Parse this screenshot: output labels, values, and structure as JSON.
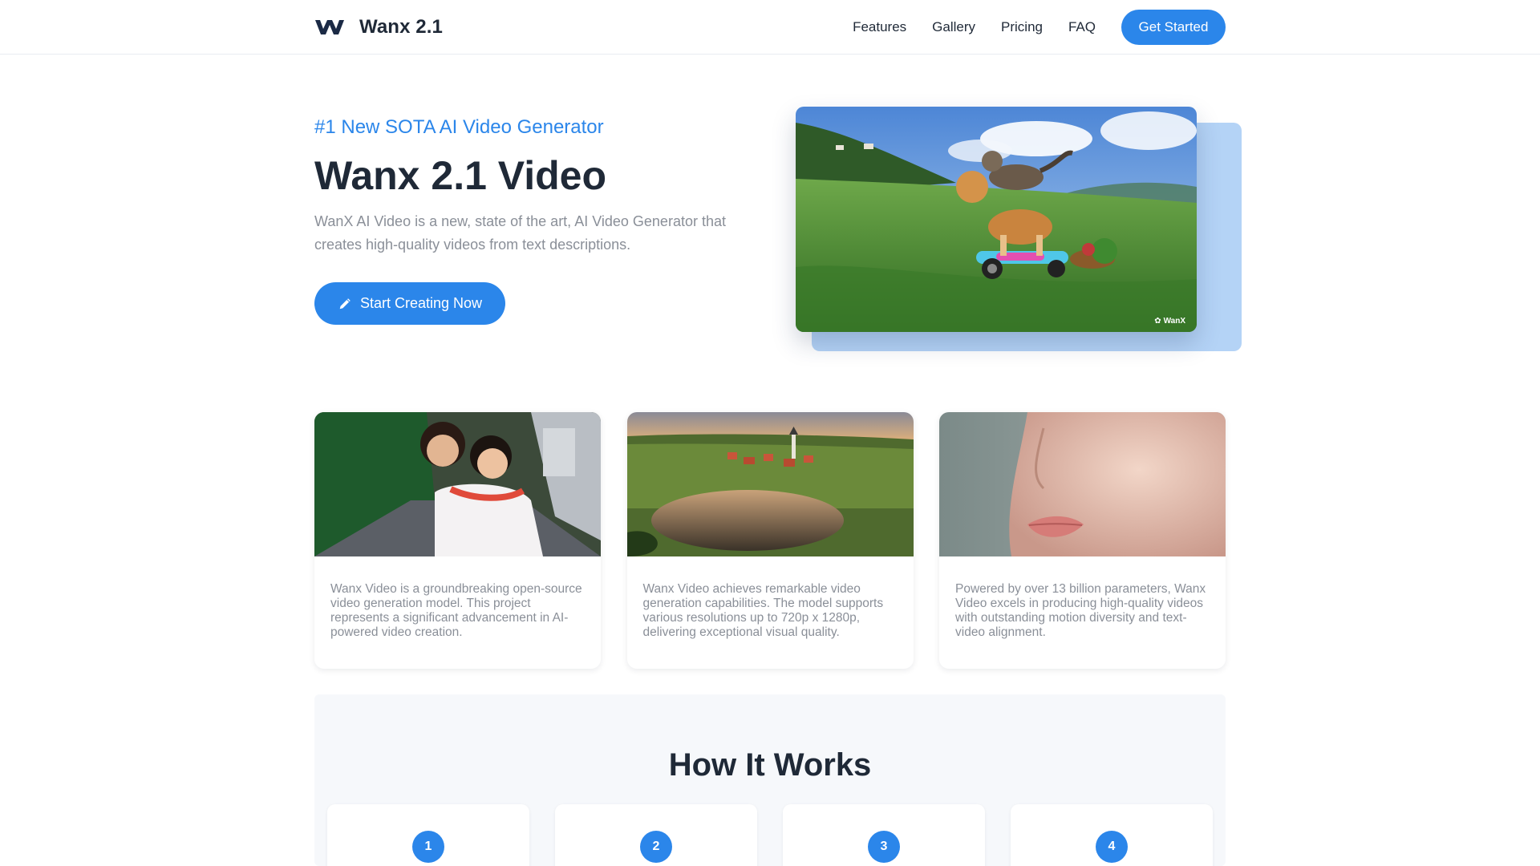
{
  "nav": {
    "brand": "Wanx 2.1",
    "links": [
      "Features",
      "Gallery",
      "Pricing",
      "FAQ"
    ],
    "cta": "Get Started"
  },
  "hero": {
    "eyebrow": "#1 New SOTA AI Video Generator",
    "title": "Wanx 2.1 Video",
    "description": "WanX AI Video is a new, state of the art, AI Video Generator that creates high-quality videos from text descriptions.",
    "cta": "Start Creating Now",
    "cta_icon": "pencil-icon",
    "video_watermark": "WanX"
  },
  "cards": [
    {
      "image": "two-women-scooter-street",
      "text": "Wanx Video is a groundbreaking open-source video generation model. This project represents a significant advancement in AI-powered video creation."
    },
    {
      "image": "village-lake-sunset",
      "text": "Wanx Video achieves remarkable video generation capabilities. The model supports various resolutions up to 720p x 1280p, delivering exceptional visual quality."
    },
    {
      "image": "face-closeup",
      "text": "Powered by over 13 billion parameters, Wanx Video excels in producing high-quality videos with outstanding motion diversity and text-video alignment."
    }
  ],
  "how_it_works": {
    "title": "How It Works",
    "steps": [
      "1",
      "2",
      "3",
      "4"
    ]
  },
  "colors": {
    "accent": "#2b86ea",
    "text_dark": "#1f2937",
    "text_muted": "#8a8f98",
    "hero_backdrop": "#b4d3f6",
    "section_bg": "#f6f8fb"
  }
}
